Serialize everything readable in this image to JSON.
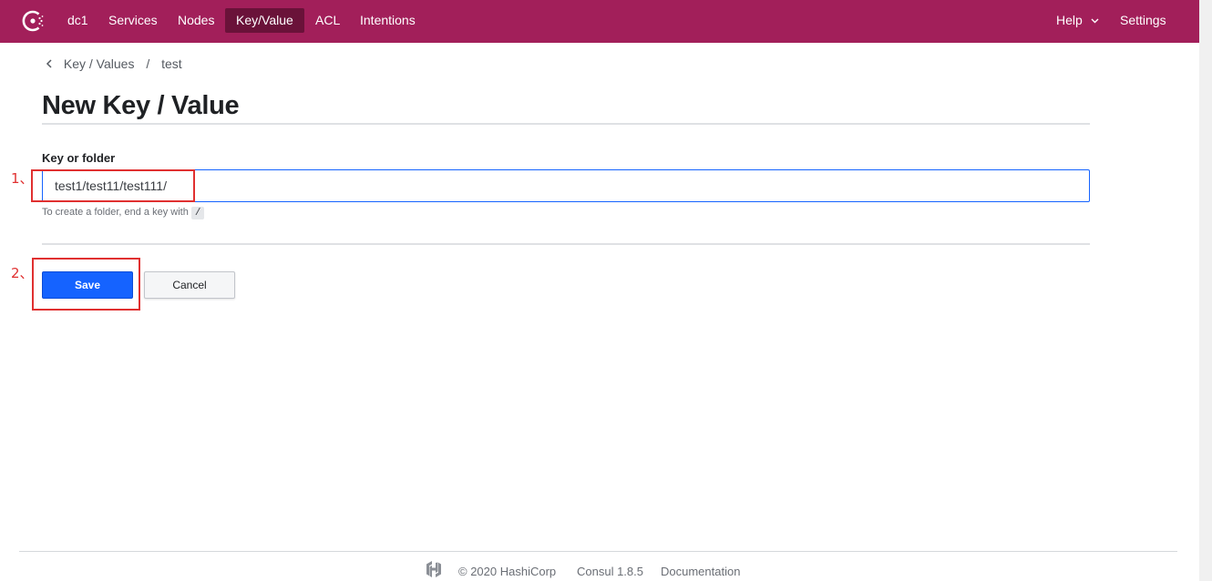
{
  "nav": {
    "datacenter": "dc1",
    "items": [
      "Services",
      "Nodes",
      "Key/Value",
      "ACL",
      "Intentions"
    ],
    "active": "Key/Value",
    "help": "Help",
    "settings": "Settings"
  },
  "breadcrumb": {
    "items": [
      "Key / Values",
      "test"
    ],
    "separator": "/"
  },
  "page_title": "New Key / Value",
  "form": {
    "key_label": "Key or folder",
    "key_value": "test1/test11/test111/",
    "hint_text": "To create a folder, end a key with",
    "hint_code": "/",
    "save_label": "Save",
    "cancel_label": "Cancel"
  },
  "annotations": {
    "step1": "1、",
    "step2": "2、"
  },
  "footer": {
    "copyright": "© 2020 HashiCorp",
    "version": "Consul 1.8.5",
    "docs": "Documentation"
  },
  "colors": {
    "brand": "#a21f5a",
    "nav_active": "#6a1239",
    "primary": "#1563ff",
    "annotation": "#e03030"
  }
}
